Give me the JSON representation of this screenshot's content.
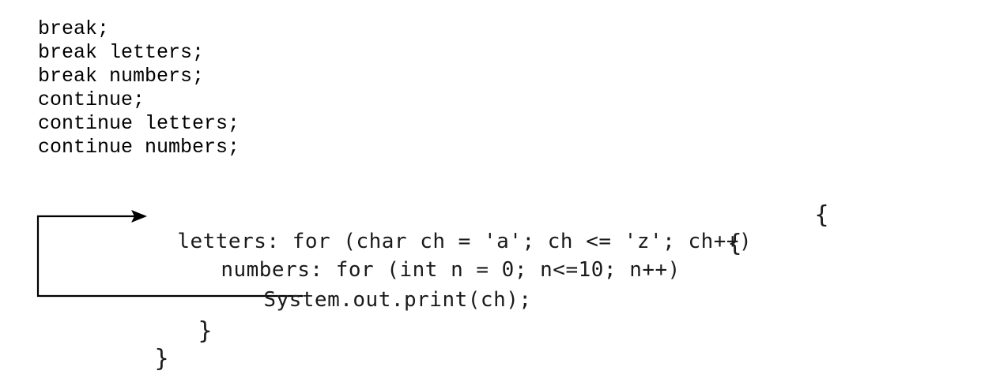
{
  "statements": [
    "break;",
    "break letters;",
    "break numbers;",
    "continue;",
    "continue letters;",
    "continue numbers;"
  ],
  "code": {
    "outer_loop": "letters: for (char ch = 'a'; ch <= 'z'; ch++)",
    "inner_loop": "numbers: for (int n = 0; n<=10; n++)",
    "body": "System.out.print(ch);",
    "open_brace": "{",
    "close_brace": "}"
  }
}
